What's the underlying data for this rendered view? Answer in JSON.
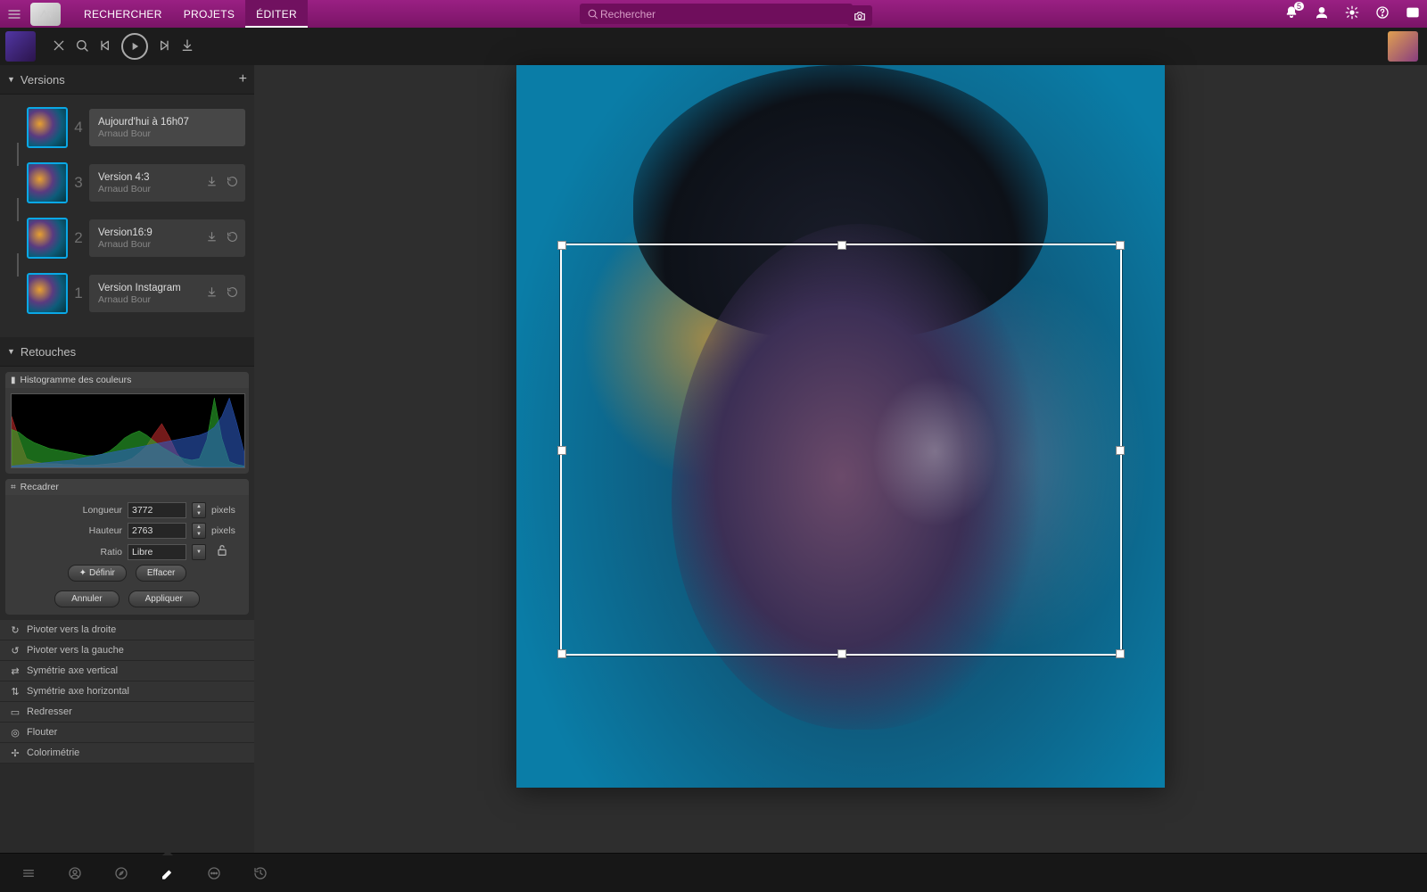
{
  "topnav": {
    "tabs": [
      {
        "label": "RECHERCHER",
        "active": false
      },
      {
        "label": "PROJETS",
        "active": false
      },
      {
        "label": "ÉDITER",
        "active": true
      }
    ],
    "search_placeholder": "Rechercher",
    "notif_count": "5"
  },
  "versions": {
    "title": "Versions",
    "items": [
      {
        "num": "4",
        "label": "Aujourd'hui à 16h07",
        "author": "Arnaud Bour",
        "active": true,
        "actions": false
      },
      {
        "num": "3",
        "label": "Version 4:3",
        "author": "Arnaud Bour",
        "active": false,
        "actions": true
      },
      {
        "num": "2",
        "label": "Version16:9",
        "author": "Arnaud Bour",
        "active": false,
        "actions": true
      },
      {
        "num": "1",
        "label": "Version Instagram",
        "author": "Arnaud Bour",
        "active": false,
        "actions": true
      }
    ]
  },
  "retouches": {
    "title": "Retouches",
    "histogram_label": "Histogramme des couleurs",
    "crop": {
      "title": "Recadrer",
      "length_label": "Longueur",
      "length_value": "3772",
      "height_label": "Hauteur",
      "height_value": "2763",
      "unit": "pixels",
      "ratio_label": "Ratio",
      "ratio_value": "Libre",
      "define_btn": "Définir",
      "clear_btn": "Effacer",
      "cancel_btn": "Annuler",
      "apply_btn": "Appliquer"
    },
    "tools": [
      {
        "icon": "↻",
        "label": "Pivoter vers la droite"
      },
      {
        "icon": "↺",
        "label": "Pivoter vers la gauche"
      },
      {
        "icon": "⇄",
        "label": "Symétrie axe vertical"
      },
      {
        "icon": "⇅",
        "label": "Symétrie axe horizontal"
      },
      {
        "icon": "▭",
        "label": "Redresser"
      },
      {
        "icon": "◎",
        "label": "Flouter"
      },
      {
        "icon": "✢",
        "label": "Colorimétrie"
      }
    ]
  },
  "chart_data": {
    "type": "area",
    "title": "Histogramme des couleurs",
    "xlabel": "",
    "ylabel": "",
    "xlim": [
      0,
      255
    ],
    "ylim": [
      0,
      100
    ],
    "series": [
      {
        "name": "red",
        "color": "#d03030",
        "values": [
          70,
          40,
          12,
          8,
          6,
          5,
          5,
          4,
          4,
          3,
          3,
          3,
          4,
          5,
          6,
          8,
          12,
          20,
          30,
          46,
          60,
          42,
          20,
          6,
          2,
          1,
          0,
          0,
          0,
          0,
          0,
          0
        ]
      },
      {
        "name": "green",
        "color": "#30c030",
        "values": [
          52,
          48,
          40,
          34,
          30,
          26,
          24,
          22,
          20,
          18,
          16,
          16,
          18,
          22,
          30,
          40,
          46,
          50,
          44,
          36,
          28,
          22,
          16,
          12,
          10,
          12,
          38,
          95,
          40,
          8,
          4,
          2
        ]
      },
      {
        "name": "blue",
        "color": "#3060d0",
        "values": [
          2,
          3,
          4,
          5,
          6,
          7,
          8,
          9,
          10,
          12,
          14,
          16,
          18,
          20,
          22,
          24,
          26,
          28,
          30,
          32,
          34,
          36,
          38,
          40,
          42,
          44,
          48,
          55,
          70,
          95,
          60,
          20
        ]
      }
    ]
  },
  "crop_box": {
    "left_pct": 6.7,
    "top_pct": 24.7,
    "width_pct": 86.2,
    "height_pct": 56.5
  }
}
